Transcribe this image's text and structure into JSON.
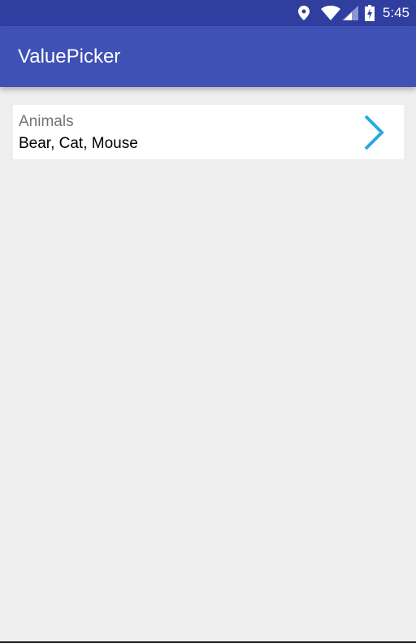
{
  "status_bar": {
    "time": "5:45",
    "icons": [
      "location-icon",
      "wifi-icon",
      "signal-icon",
      "battery-charging-icon"
    ],
    "background": "#303f9f"
  },
  "app_bar": {
    "title": "ValuePicker",
    "background": "#3f51b5"
  },
  "picker": {
    "label": "Animals",
    "value": "Bear, Cat, Mouse",
    "icon": "chevron-right-icon",
    "accent": "#29abe2"
  },
  "page": {
    "background": "#eeeeee"
  }
}
